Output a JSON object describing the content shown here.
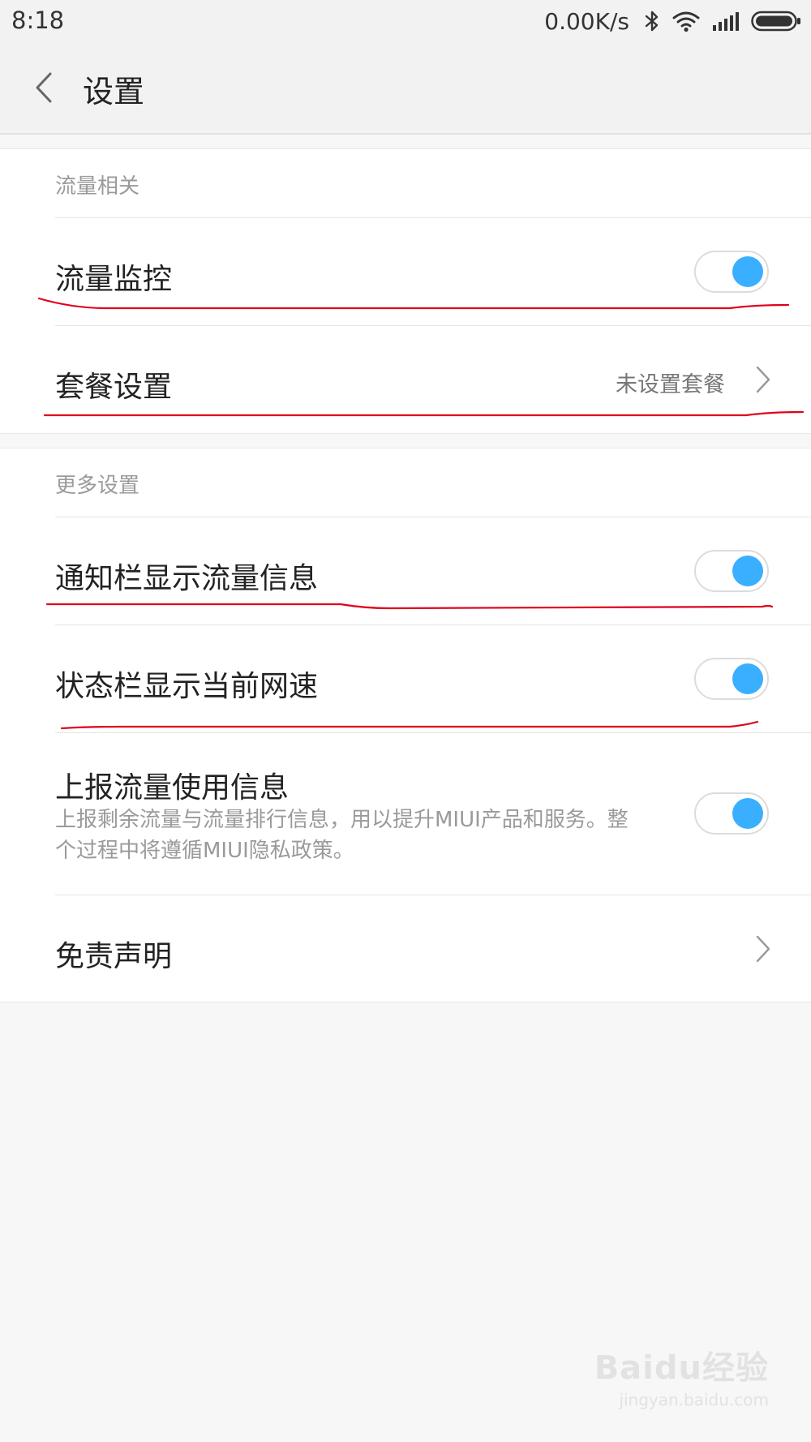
{
  "status_bar": {
    "time": "8:18",
    "network_speed": "0.00K/s",
    "icons": [
      "bluetooth-icon",
      "wifi-icon",
      "signal-icon",
      "battery-icon"
    ]
  },
  "header": {
    "title": "设置",
    "back_icon": "chevron-left-icon"
  },
  "sections": [
    {
      "header": "流量相关",
      "items": [
        {
          "label": "流量监控",
          "type": "toggle",
          "checked": true
        },
        {
          "label": "套餐设置",
          "type": "link",
          "value": "未设置套餐"
        }
      ]
    },
    {
      "header": "更多设置",
      "items": [
        {
          "label": "通知栏显示流量信息",
          "type": "toggle",
          "checked": true
        },
        {
          "label": "状态栏显示当前网速",
          "type": "toggle",
          "checked": true
        },
        {
          "label": "上报流量使用信息",
          "type": "toggle",
          "checked": true,
          "summary": "上报剩余流量与流量排行信息，用以提升MIUI产品和服务。整个过程中将遵循MIUI隐私政策。"
        },
        {
          "label": "免责声明",
          "type": "link"
        }
      ]
    }
  ],
  "watermark": {
    "brand": "Baidu经验",
    "url": "jingyan.baidu.com"
  },
  "colors": {
    "accent": "#3aaeff",
    "annotation": "#e0001b",
    "page_background": "#f7f7f7",
    "card_background": "#ffffff"
  }
}
